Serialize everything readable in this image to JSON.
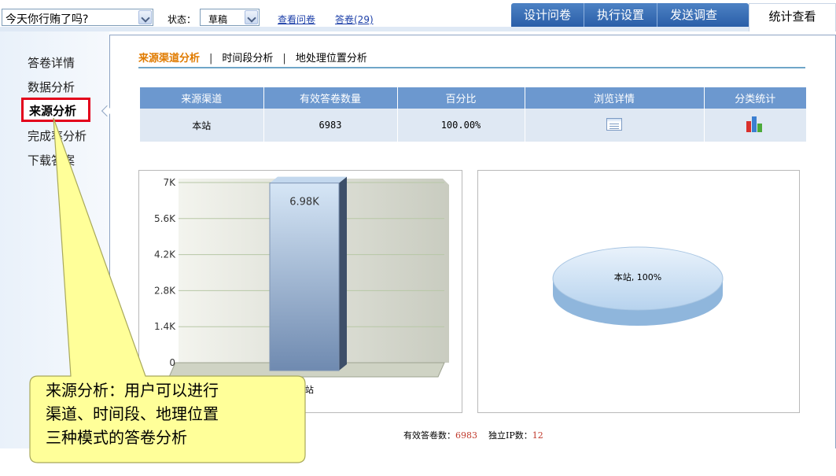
{
  "topbar": {
    "survey_value": "今天你行贿了吗?",
    "status_label": "状态：",
    "status_value": "草稿",
    "link_view": "查看问卷",
    "link_answers": "答卷(29)",
    "tabs": [
      "设计问卷",
      "执行设置",
      "发送调查"
    ],
    "active_tab": "统计查看"
  },
  "sidebar": {
    "items": [
      "答卷详情",
      "数据分析",
      "来源分析",
      "完成率分析",
      "下载答案"
    ],
    "active_item": "来源分析"
  },
  "subtabs": [
    "来源渠道分析",
    "时间段分析",
    "地处理位置分析"
  ],
  "table": {
    "headers": [
      "来源渠道",
      "有效答卷数量",
      "百分比",
      "浏览详情",
      "分类统计"
    ],
    "row": {
      "channel": "本站",
      "count": "6983",
      "percent": "100.00%"
    }
  },
  "chart_data": [
    {
      "type": "bar",
      "categories": [
        "本站"
      ],
      "values": [
        6980
      ],
      "data_labels": [
        "6.98K"
      ],
      "yticks": [
        "7K",
        "5.6K",
        "4.2K",
        "2.8K",
        "1.4K",
        "0"
      ],
      "ylim": [
        0,
        7000
      ],
      "grid": true,
      "xlabel": "",
      "ylabel": "",
      "title": ""
    },
    {
      "type": "pie",
      "slices": [
        {
          "label": "本站",
          "value": 100
        }
      ],
      "slice_labels": [
        "本站, 100%"
      ],
      "title": ""
    }
  ],
  "footer": {
    "valid_label": "有效答卷数：",
    "valid_value": "6983",
    "ip_label": "独立IP数：",
    "ip_value": "12"
  },
  "callout": {
    "lines": [
      "来源分析：用户可以进行",
      "渠道、时间段、地理位置",
      "三种模式的答卷分析"
    ]
  },
  "colors": {
    "tab_blue": "#2a5ea8",
    "table_header": "#6c98cf",
    "highlight_red": "#e3001b",
    "accent_orange": "#e07b00",
    "callout_fill": "#ffff99"
  }
}
